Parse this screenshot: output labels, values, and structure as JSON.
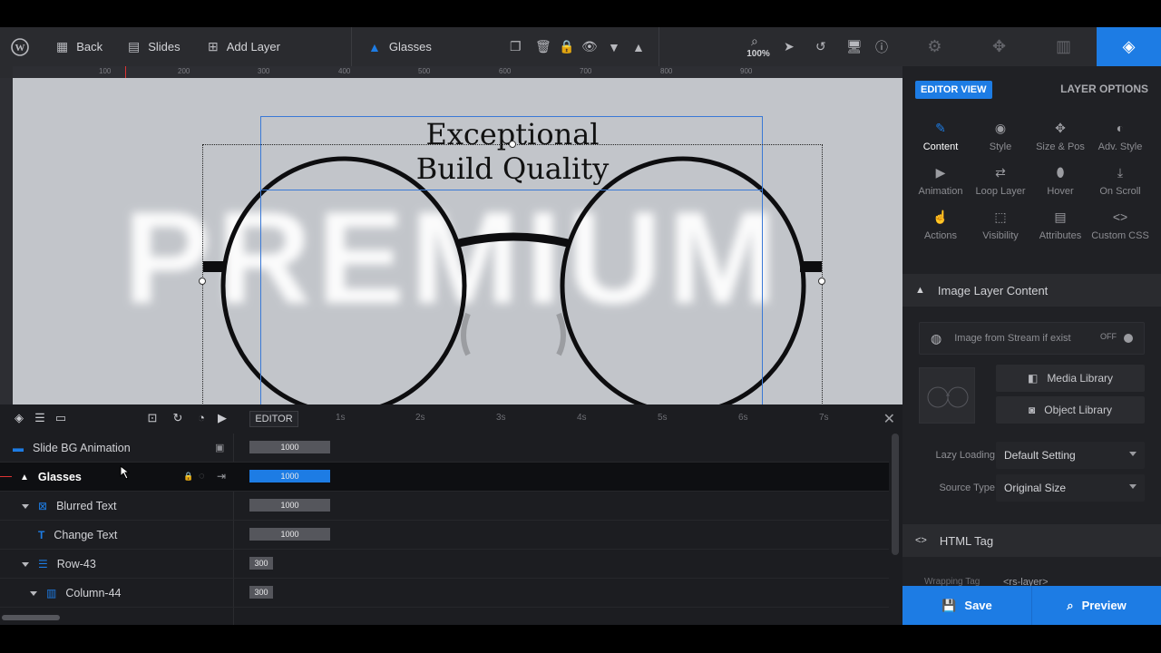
{
  "toolbar": {
    "back_label": "Back",
    "slides_label": "Slides",
    "add_layer_label": "Add Layer",
    "current_layer": "Glasses",
    "zoom": "100%"
  },
  "ruler": {
    "h_ticks": [
      "100",
      "200",
      "300",
      "400",
      "500",
      "600",
      "700",
      "800",
      "900"
    ]
  },
  "canvas": {
    "headline_line1": "Exceptional",
    "headline_line2": "Build Quality",
    "background_text": "PREMIUM"
  },
  "panel": {
    "editor_view": "EDITOR VIEW",
    "layer_options": "LAYER OPTIONS",
    "options": [
      {
        "label": "Content",
        "icon": "pencil-icon"
      },
      {
        "label": "Style",
        "icon": "palette-icon"
      },
      {
        "label": "Size & Pos",
        "icon": "move-icon"
      },
      {
        "label": "Adv. Style",
        "icon": "contrast-icon"
      },
      {
        "label": "Animation",
        "icon": "play-icon"
      },
      {
        "label": "Loop Layer",
        "icon": "loop-icon"
      },
      {
        "label": "Hover",
        "icon": "mouse-icon"
      },
      {
        "label": "On Scroll",
        "icon": "scroll-icon"
      },
      {
        "label": "Actions",
        "icon": "hand-icon"
      },
      {
        "label": "Visibility",
        "icon": "visibility-icon"
      },
      {
        "label": "Attributes",
        "icon": "document-icon"
      },
      {
        "label": "Custom CSS",
        "icon": "code-icon"
      }
    ],
    "image_section_title": "Image Layer Content",
    "stream_label": "Image from Stream if exist",
    "stream_toggle": "OFF",
    "media_library": "Media Library",
    "object_library": "Object Library",
    "lazy_loading_label": "Lazy Loading",
    "lazy_loading_value": "Default Setting",
    "source_type_label": "Source Type",
    "source_type_value": "Original Size",
    "html_tag_title": "HTML Tag",
    "wrapping_tag_label": "Wrapping Tag",
    "wrapping_tag_value": "<rs-layer>"
  },
  "actions": {
    "save": "Save",
    "preview": "Preview"
  },
  "timeline": {
    "editor_tag": "EDITOR",
    "time_labels": [
      "1s",
      "2s",
      "3s",
      "4s",
      "5s",
      "6s",
      "7s"
    ],
    "layers": [
      {
        "name": "Slide BG Animation",
        "duration": "1000"
      },
      {
        "name": "Glasses",
        "duration": "1000"
      },
      {
        "name": "Blurred Text",
        "duration": "1000"
      },
      {
        "name": "Change Text",
        "duration": "1000"
      },
      {
        "name": "Row-43",
        "duration": "300"
      },
      {
        "name": "Column-44",
        "duration": "300"
      }
    ]
  }
}
